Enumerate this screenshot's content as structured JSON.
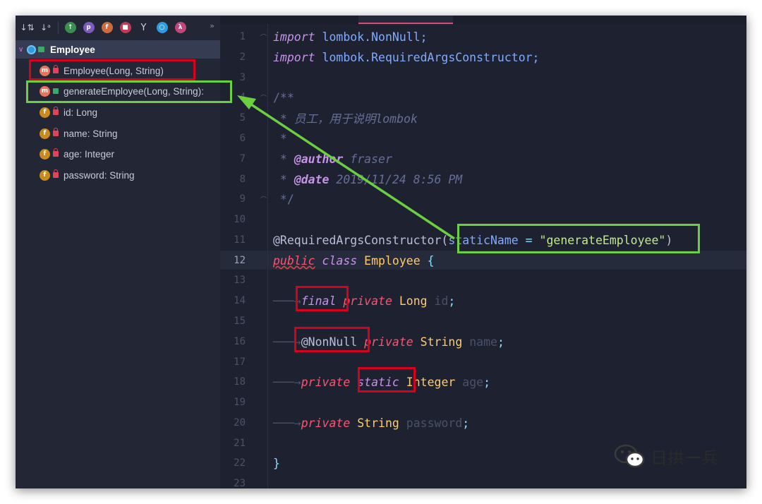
{
  "toolbar": {
    "sort_by_type_icon": "↓⇅",
    "sort_alpha_icon": "↓ᵃ",
    "more_icon": "»"
  },
  "structure": {
    "root": {
      "label": "Employee"
    },
    "items": [
      {
        "kind": "m",
        "label": "Employee(Long, String)"
      },
      {
        "kind": "m",
        "label": "generateEmployee(Long, String):"
      },
      {
        "kind": "f",
        "label": "id: Long"
      },
      {
        "kind": "f",
        "label": "name: String"
      },
      {
        "kind": "f",
        "label": "age: Integer"
      },
      {
        "kind": "f",
        "label": "password: String"
      }
    ]
  },
  "editor": {
    "line_numbers": [
      "1",
      "2",
      "3",
      "4",
      "5",
      "6",
      "7",
      "8",
      "9",
      "10",
      "11",
      "12",
      "13",
      "14",
      "15",
      "16",
      "17",
      "18",
      "19",
      "20",
      "21",
      "22",
      "23"
    ],
    "code": {
      "l1_kw": "import",
      "l1_pkg": "lombok.NonNull;",
      "l2_kw": "import",
      "l2_pkg": "lombok.RequiredArgsConstructor;",
      "l4": "/**",
      "l5_star": " * ",
      "l5_text": "员工，用于说明lombok",
      "l6": " *",
      "l7_star": " * ",
      "l7_tag": "@author",
      "l7_val": " fraser",
      "l8_star": " * ",
      "l8_tag": "@date",
      "l8_val": " 2019/11/24 8:56 PM",
      "l9": " */",
      "l11_ann": "@RequiredArgsConstructor",
      "l11_name": "staticName",
      "l11_eq": " = ",
      "l11_str": "\"generateEmployee\"",
      "l11_close": ")",
      "l11_open": "(",
      "l12_public": "public",
      "l12_class": "class",
      "l12_name": "Employee",
      "l12_brace": "{",
      "l14_final": "final",
      "l14_private": "private",
      "l14_type": "Long",
      "l14_var": "id",
      "l14_semi": ";",
      "l16_ann": "@NonNull",
      "l16_private": "private",
      "l16_type": "String",
      "l16_var": "name",
      "l16_semi": ";",
      "l18_private": "private",
      "l18_static": "static",
      "l18_type": "Integer",
      "l18_var": "age",
      "l18_semi": ";",
      "l20_private": "private",
      "l20_type": "String",
      "l20_var": "password",
      "l20_semi": ";",
      "l22": "}"
    }
  },
  "watermark": {
    "text": "日拱一兵"
  },
  "colors": {
    "highlight_red": "#d7001d",
    "highlight_green": "#6ccf3f",
    "editor_bg": "#1e2230",
    "sidebar_bg": "#222635"
  }
}
